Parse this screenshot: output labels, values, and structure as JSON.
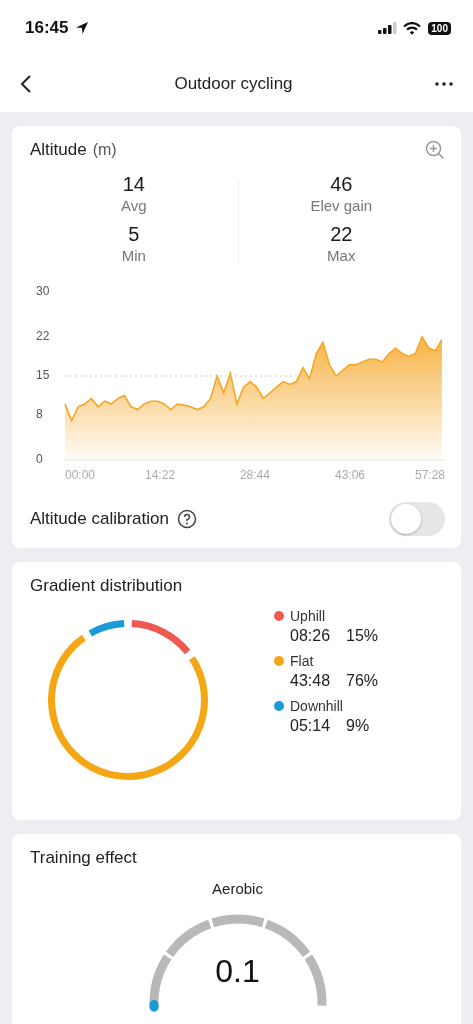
{
  "status_bar": {
    "time": "16:45",
    "battery": "100"
  },
  "nav": {
    "title": "Outdoor cycling"
  },
  "altitude": {
    "title": "Altitude",
    "unit": "(m)",
    "stats": [
      {
        "value": "14",
        "label": "Avg"
      },
      {
        "value": "46",
        "label": "Elev gain"
      },
      {
        "value": "5",
        "label": "Min"
      },
      {
        "value": "22",
        "label": "Max"
      }
    ],
    "chart_data": {
      "type": "area",
      "x": [
        0,
        1,
        2,
        3,
        4,
        5,
        6,
        7,
        8,
        9,
        10,
        11,
        12,
        13,
        14,
        15,
        16,
        17,
        18,
        19,
        20,
        21,
        22,
        23,
        24,
        25,
        26,
        27,
        28,
        29,
        30,
        31,
        32,
        33,
        34,
        35,
        36,
        37,
        38,
        39,
        40,
        41,
        42,
        43,
        44,
        45,
        46,
        47,
        48,
        49,
        50,
        51,
        52,
        53,
        54,
        55,
        56,
        57
      ],
      "series": [
        {
          "color": "#f5a623",
          "values": [
            10,
            7,
            9.5,
            10,
            11,
            9.5,
            10.5,
            10,
            11,
            11.5,
            9.5,
            9,
            10,
            10.5,
            10.5,
            10,
            9,
            10,
            9.8,
            9.5,
            9,
            9.5,
            11,
            15,
            12,
            15.5,
            10,
            13,
            14,
            13,
            11,
            12,
            13,
            14,
            13.5,
            14,
            16.5,
            14.5,
            19,
            21,
            17,
            15,
            16,
            17,
            17,
            17.5,
            18,
            18,
            17.5,
            19,
            20,
            19,
            18.5,
            19,
            22,
            20,
            19.5,
            21.5
          ]
        }
      ],
      "xlim": [
        0,
        57.47
      ],
      "ylim": [
        0,
        30
      ],
      "xticks": [
        {
          "value": 0,
          "label": "00:00"
        },
        {
          "value": 14.37,
          "label": "14:22"
        },
        {
          "value": 28.73,
          "label": "28:44"
        },
        {
          "value": 43.1,
          "label": "43:06"
        },
        {
          "value": 57.47,
          "label": "57:28"
        }
      ],
      "yticks": [
        0,
        8,
        15,
        22,
        30
      ]
    },
    "calibration": {
      "label": "Altitude calibration",
      "on": false
    }
  },
  "gradient": {
    "title": "Gradient distribution",
    "chart_data": {
      "type": "donut",
      "categories": [
        "Uphill",
        "Flat",
        "Downhill"
      ],
      "values": [
        15,
        76,
        9
      ],
      "colors": [
        "#ee5a52",
        "#f5a614",
        "#1a9ad6"
      ]
    },
    "legend": [
      {
        "time": "08:26",
        "percent": "15%",
        "color": "#ee5a52"
      },
      {
        "time": "43:48",
        "percent": "76%",
        "color": "#f5a614"
      },
      {
        "time": "05:14",
        "percent": "9%",
        "color": "#1a9ad6"
      }
    ]
  },
  "training": {
    "title": "Training effect",
    "gauge": {
      "label": "Aerobic",
      "value": "0.1"
    }
  }
}
